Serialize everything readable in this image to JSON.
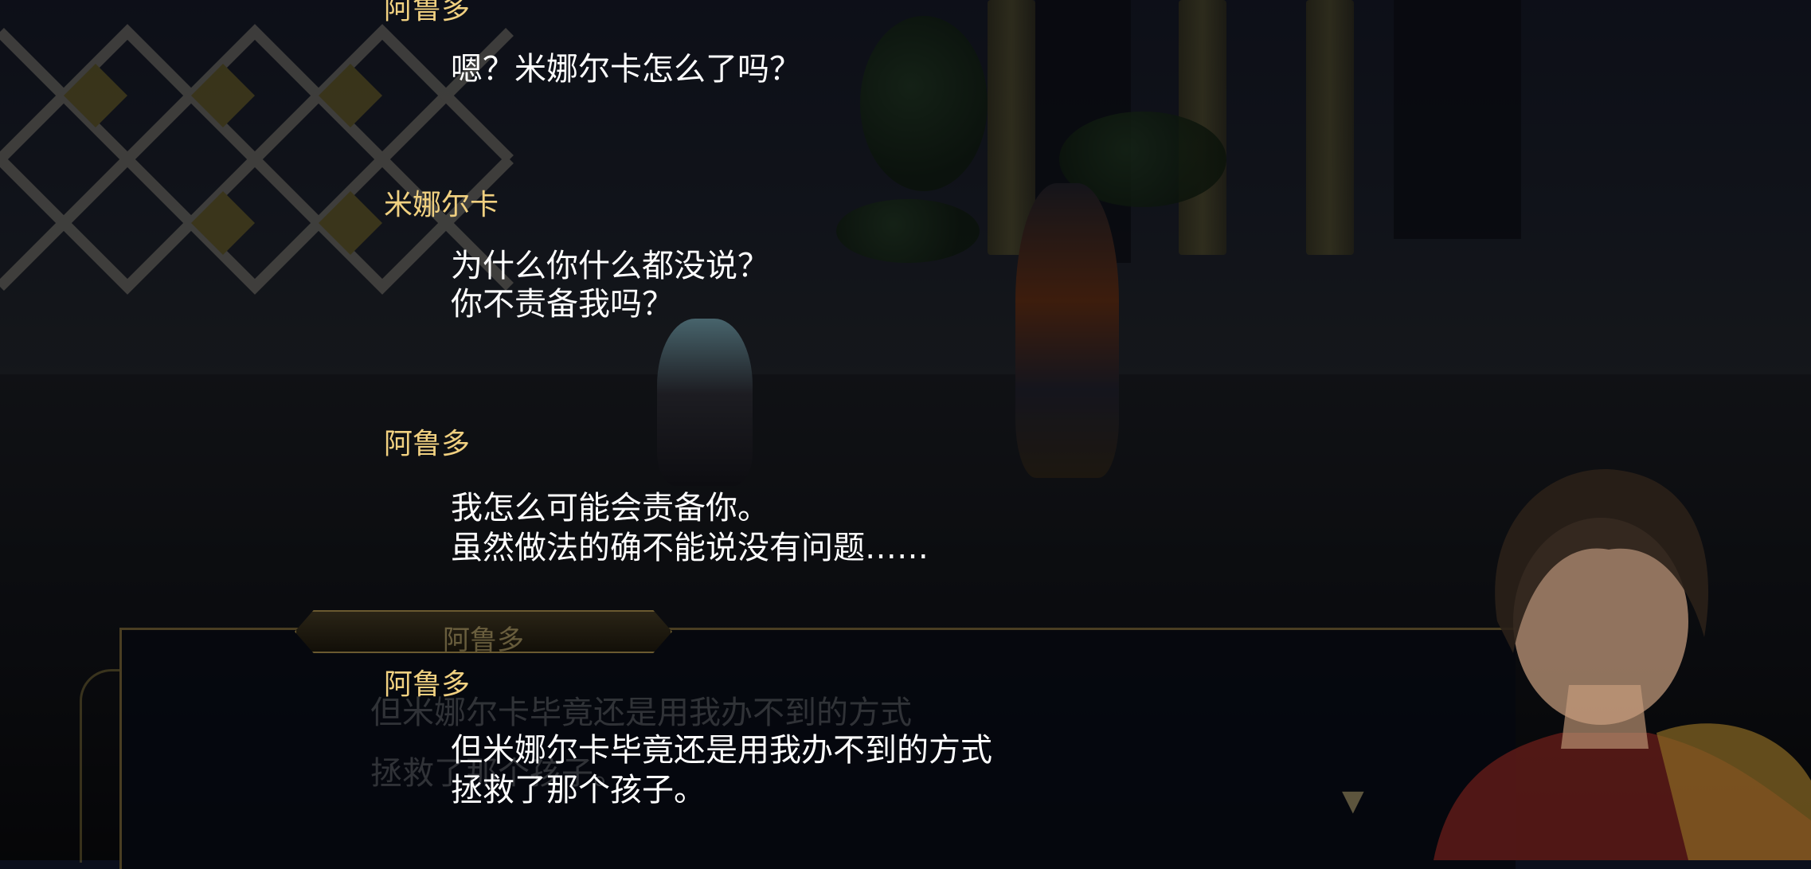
{
  "backlog": {
    "entries": [
      {
        "speaker": "阿鲁多",
        "lines": [
          "嗯？米娜尔卡怎么了吗？"
        ]
      },
      {
        "speaker": "米娜尔卡",
        "lines": [
          "为什么你什么都没说？",
          "你不责备我吗？"
        ]
      },
      {
        "speaker": "阿鲁多",
        "lines": [
          "我怎么可能会责备你。",
          "虽然做法的确不能说没有问题……"
        ]
      },
      {
        "speaker": "阿鲁多",
        "lines": [
          "但米娜尔卡毕竟还是用我办不到的方式",
          "拯救了那个孩子。"
        ]
      }
    ]
  },
  "message_window": {
    "speaker": "阿鲁多",
    "lines": [
      "但米娜尔卡毕竟还是用我办不到的方式",
      "拯救了那个孩子。"
    ]
  },
  "icons": {
    "next": "next-arrow-icon"
  },
  "colors": {
    "speaker_name": "#f0d080",
    "dialogue_text": "#ffffff",
    "overlay": "rgba(0,0,0,0.5)"
  }
}
